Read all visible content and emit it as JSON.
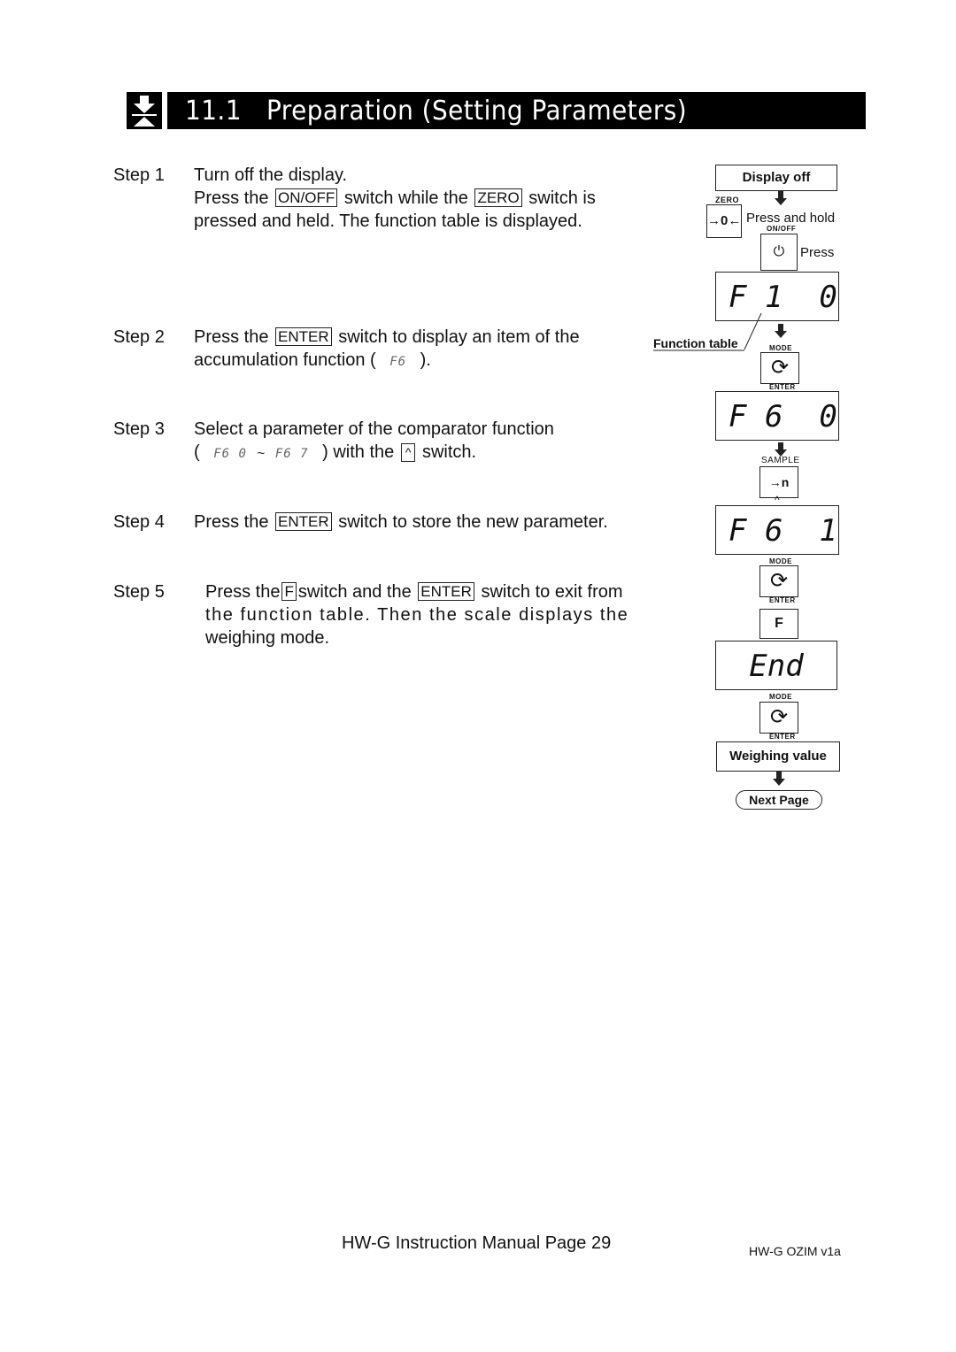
{
  "header": {
    "icon": "down-arrow-to-bar-icon",
    "title": "11.1   Preparation (Setting Parameters)"
  },
  "steps": [
    {
      "label": "Step  1",
      "lines": [
        "Turn off the display.",
        {
          "pre": "Press the",
          "key1": "ON/OFF",
          "mid": "switch while the",
          "key2": "ZERO",
          "post": "switch is"
        },
        "pressed and held. The function table is displayed."
      ]
    },
    {
      "label": "Step  2",
      "line1_pre": "Press the",
      "line1_key": "ENTER",
      "line1_post": "switch to display an item of the",
      "line2_pre": "accumulation function (",
      "line2_seg": "F6",
      "line2_post": ")."
    },
    {
      "label": "Step  3",
      "line1": "Select a parameter of the comparator function",
      "line2_open": "(",
      "line2_seg1": "F6 0",
      "line2_tilde": "~",
      "line2_seg2": "F6 7",
      "line2_pre": ") with the",
      "line2_key": "^",
      "line2_post": "switch."
    },
    {
      "label": "Step  4",
      "pre": "Press the",
      "key": "ENTER",
      "post": "switch to store the new parameter."
    },
    {
      "label": "Step 5",
      "line1_pre": "Press the",
      "line1_key1": "F",
      "line1_mid": "switch and the",
      "line1_key2": "ENTER",
      "line1_post": "switch to exit from",
      "line2": "the function table. Then the scale displays the",
      "line3": "weighing mode."
    }
  ],
  "diagram": {
    "display_off": "Display off",
    "zero_label": "ZERO",
    "zero_glyph": "→0←",
    "press_and_hold": "Press and hold",
    "onoff_label": "ON/OFF",
    "onoff_glyph": "⏻",
    "press": "Press",
    "lcd1": "F 1  0",
    "function_table": "Function table",
    "mode_label": "MODE",
    "enter_label": "ENTER",
    "cycle_glyph": "⟳",
    "lcd2": "F 6  0",
    "sample_label": "SAMPLE",
    "sample_glyph": "→n",
    "caret": "^",
    "lcd3": "F 6  1",
    "f_key": "F",
    "lcd4": "End",
    "weighing_value": "Weighing value",
    "next_page": "Next Page"
  },
  "footer": {
    "page": "HW-G Instruction Manual Page 29",
    "version": "HW-G OZIM v1a"
  }
}
